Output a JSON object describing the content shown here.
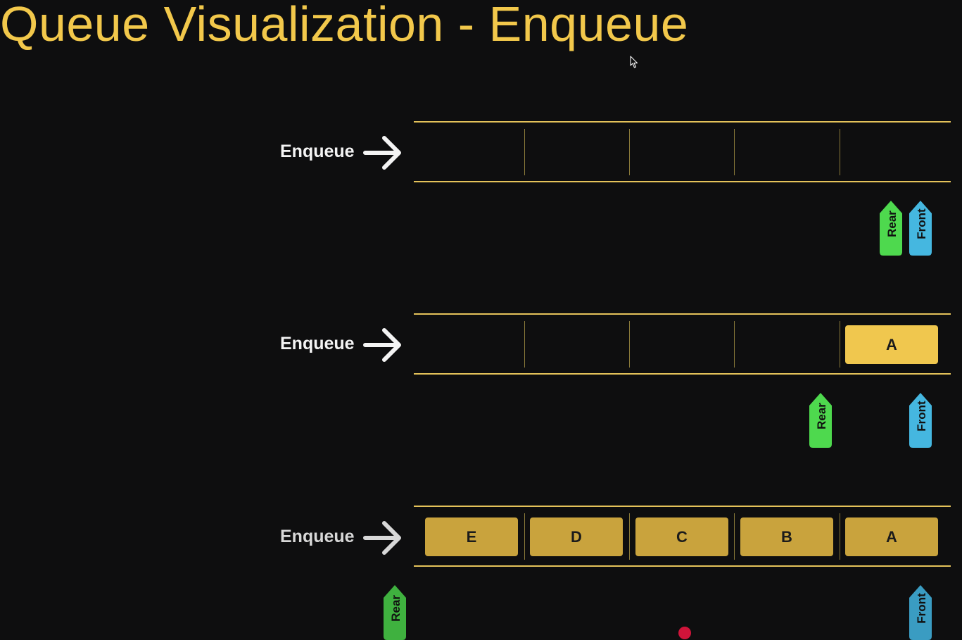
{
  "title": "Queue Visualization - Enqueue",
  "colors": {
    "background": "#0e0e0f",
    "title": "#f2c84b",
    "rail": "#e4c25a",
    "slot_filled": "#f0c74e",
    "slot_dim": "#c9a33d",
    "rear_pointer": "#4ed94e",
    "front_pointer": "#45b7e0"
  },
  "rows": [
    {
      "action_label": "Enqueue",
      "slots": [
        "",
        "",
        "",
        "",
        ""
      ],
      "rear_label": "Rear",
      "front_label": "Front"
    },
    {
      "action_label": "Enqueue",
      "slots": [
        "",
        "",
        "",
        "",
        "A"
      ],
      "rear_label": "Rear",
      "front_label": "Front"
    },
    {
      "action_label": "Enqueue",
      "slots": [
        "E",
        "D",
        "C",
        "B",
        "A"
      ],
      "rear_label": "Rear",
      "front_label": "Front"
    }
  ]
}
